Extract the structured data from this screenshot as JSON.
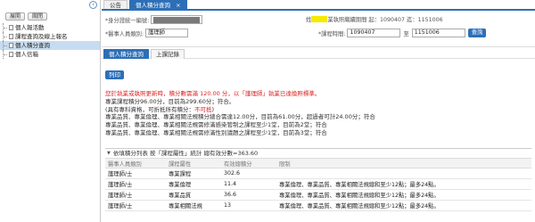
{
  "sidebar": {
    "buttons": [
      "展開",
      "關閉"
    ],
    "items": [
      {
        "label": "個人報活動",
        "active": false
      },
      {
        "label": "課程查詢及線上報名",
        "active": false
      },
      {
        "label": "個人積分查詢",
        "active": true
      },
      {
        "label": "個人信箱",
        "active": false
      }
    ]
  },
  "tabs": [
    {
      "label": "公告",
      "active": false
    },
    {
      "label": "個人積分查詢",
      "active": true,
      "close": "×"
    }
  ],
  "form": {
    "id_label": "*身分證統一編號:",
    "category_label": "*醫事人員類別:",
    "category_value": "護理師",
    "name_prefix": "姓",
    "name_suffix": "業執照繼續期間 起：1090407 迄：1151006",
    "period_label": "*課程時間:",
    "period_from": "1090407",
    "period_sep": "至",
    "period_to": "1151006",
    "search_button": "查詢"
  },
  "subtabs": [
    {
      "label": "個人積分查詢",
      "active": true
    },
    {
      "label": "上課記錄",
      "active": false
    }
  ],
  "print_button": "列印",
  "info": {
    "line1": "您於執業或執照更新時，積分數需滿 120.00 分，以「護理師」執業已達換照標準。",
    "line2": "專業課程積分96.00分，目前為299.60分；符合。",
    "line3_prefix": "(具有專科資格，可折抵所有積分：",
    "line3_red": "不可抵",
    "line3_suffix": ")",
    "line4": "專業品質、專業倫理、專業相關法規積分總合需達12.00分，目前為61.00分，超過者可計24.00分；符合",
    "line5": "專業品質、專業倫理、專業相關法規需修滿感染管制之課程至少1堂，目前為2堂；符合",
    "line6": "專業品質、專業倫理、專業相關法規需修滿性別議題之課程至少1堂，目前為3堂；符合"
  },
  "table": {
    "title": "依填積分列表 按「課程屬性」統計  總有效分數=363.60",
    "columns": [
      "醫事人員類別",
      "課程屬性",
      "有效總積分",
      "限制"
    ],
    "rows": [
      [
        "護理師/士",
        "專業課程",
        "302.6",
        ""
      ],
      [
        "護理師/士",
        "專業倫理",
        "11.4",
        "專業倫理、專業品質、專業相關法規總和至少12點；最多24點。"
      ],
      [
        "護理師/士",
        "專業品質",
        "36.6",
        "專業倫理、專業品質、專業相關法規總和至少12點；最多24點。"
      ],
      [
        "護理師/士",
        "專業相關法規",
        "13",
        "專業倫理、專業品質、專業相關法規總和至少12點；最多24點。"
      ]
    ]
  }
}
